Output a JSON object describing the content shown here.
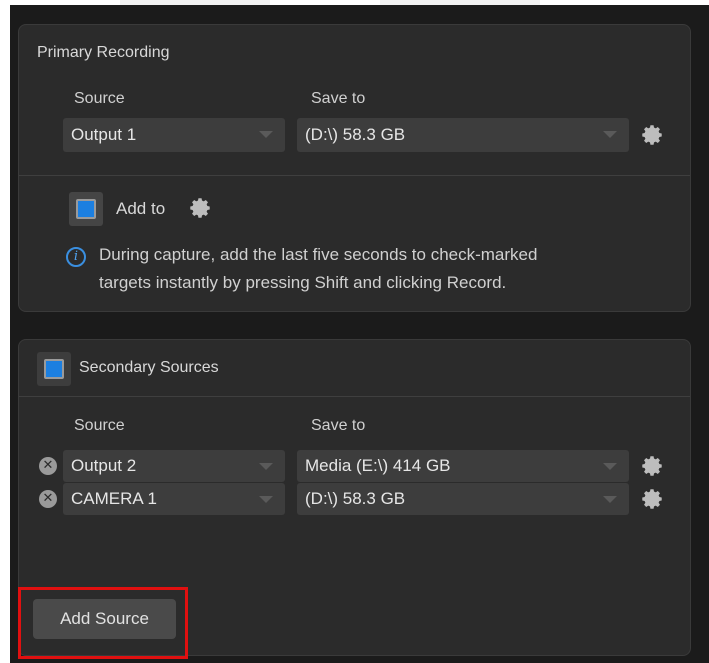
{
  "primary": {
    "title": "Primary Recording",
    "source_label": "Source",
    "save_to_label": "Save to",
    "source_value": "Output 1",
    "save_to_value": "(D:\\) 58.3 GB",
    "add_to_label": "Add to",
    "add_to_checked": true,
    "info_line1": "During capture, add the last five seconds to check-marked",
    "info_line2": "targets instantly by pressing Shift and clicking Record."
  },
  "secondary": {
    "title": "Secondary Sources",
    "enabled": true,
    "source_label": "Source",
    "save_to_label": "Save to",
    "rows": [
      {
        "source": "Output 2",
        "save_to": "Media (E:\\) 414 GB"
      },
      {
        "source": "CAMERA 1",
        "save_to": "(D:\\) 58.3 GB"
      }
    ]
  },
  "add_source_label": "Add Source",
  "colors": {
    "accent_blue": "#1c7fe0",
    "highlight_red": "#e01010",
    "panel_bg": "#2b2b2b",
    "window_bg": "#1b1b1b"
  },
  "icons": [
    "gear-icon",
    "info-icon",
    "remove-icon",
    "chevron-down-icon"
  ]
}
